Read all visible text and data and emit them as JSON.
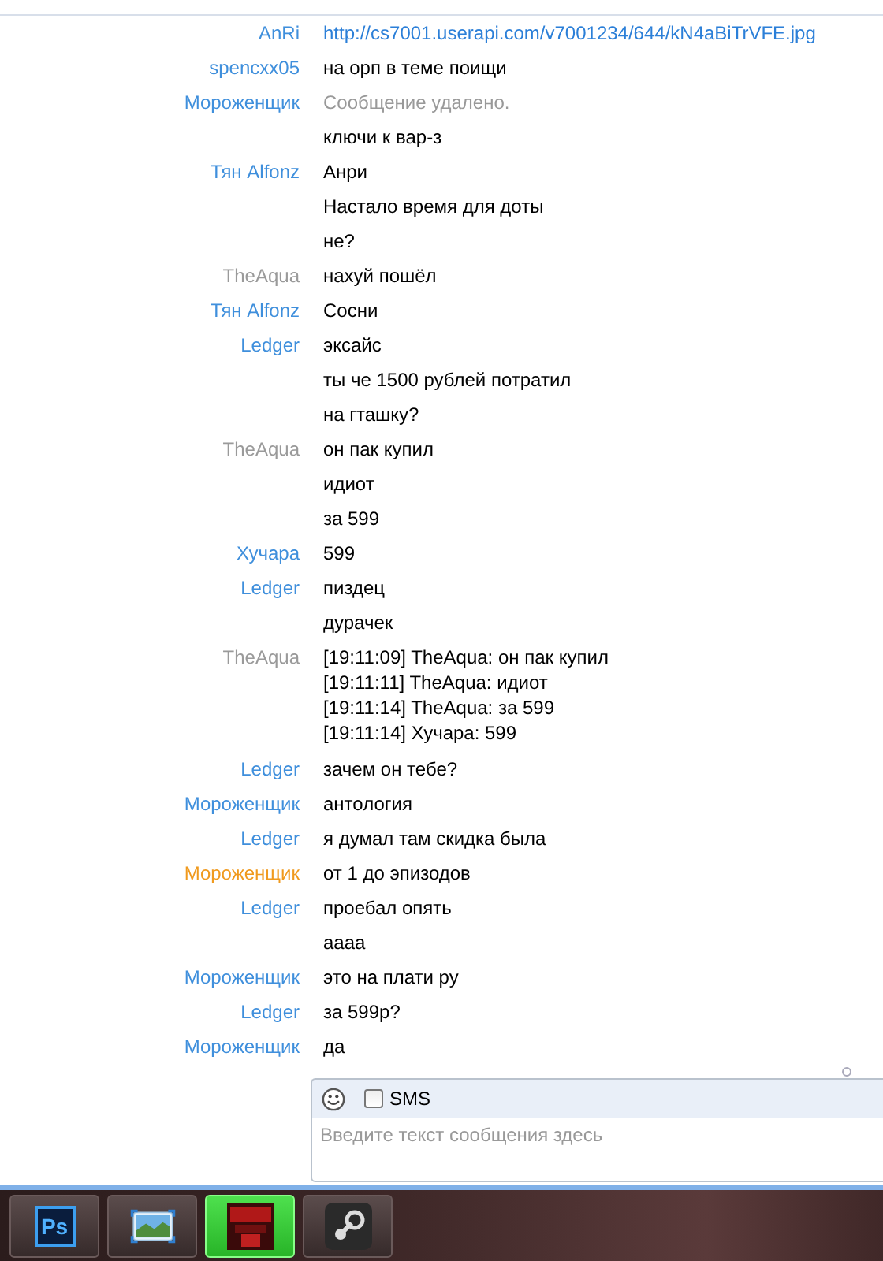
{
  "messages": [
    {
      "author": "AnRi",
      "color": "#3f8fdc",
      "kind": "link",
      "text": "http://cs7001.userapi.com/v7001234/644/kN4aBiTrVFE.jpg"
    },
    {
      "author": "spencxx05",
      "color": "#3f8fdc",
      "kind": "text",
      "text": "на орп в теме поищи"
    },
    {
      "author": "Мороженщик",
      "color": "#3f8fdc",
      "kind": "deleted",
      "text": "Сообщение удалено."
    },
    {
      "kind": "text",
      "text": "ключи к вар-з"
    },
    {
      "author": "Тян Alfonz",
      "color": "#3f8fdc",
      "kind": "text",
      "text": "Анри"
    },
    {
      "kind": "text",
      "text": "Настало время для доты"
    },
    {
      "kind": "text",
      "text": "не?"
    },
    {
      "author": "TheAqua",
      "color": "#9a9a9a",
      "kind": "text",
      "text": "нахуй пошёл"
    },
    {
      "author": "Тян Alfonz",
      "color": "#3f8fdc",
      "kind": "text",
      "text": "Сосни"
    },
    {
      "author": "Ledger",
      "color": "#3f8fdc",
      "kind": "text",
      "text": "эксайс"
    },
    {
      "kind": "text",
      "text": "ты че 1500 рублей потратил"
    },
    {
      "kind": "text",
      "text": "на гташку?"
    },
    {
      "author": "TheAqua",
      "color": "#9a9a9a",
      "kind": "text",
      "text": "он пак купил"
    },
    {
      "kind": "text",
      "text": "идиот"
    },
    {
      "kind": "text",
      "text": "за 599"
    },
    {
      "author": "Хучара",
      "color": "#3f8fdc",
      "kind": "text",
      "text": "599"
    },
    {
      "author": "Ledger",
      "color": "#3f8fdc",
      "kind": "text",
      "text": "пиздец"
    },
    {
      "kind": "text",
      "text": "дурачек"
    },
    {
      "author": "TheAqua",
      "color": "#9a9a9a",
      "kind": "log",
      "lines": [
        "[19:11:09] TheAqua: он пак купил",
        "[19:11:11] TheAqua: идиот",
        "[19:11:14] TheAqua: за 599",
        "[19:11:14] Хучара: 599"
      ]
    },
    {
      "author": "Ledger",
      "color": "#3f8fdc",
      "kind": "text",
      "text": "зачем он тебе?"
    },
    {
      "author": "Мороженщик",
      "color": "#3f8fdc",
      "kind": "text",
      "text": "антология"
    },
    {
      "author": "Ledger",
      "color": "#3f8fdc",
      "kind": "text",
      "text": "я думал там скидка была"
    },
    {
      "author": "Мороженщик",
      "color": "#f09a1e",
      "kind": "text",
      "text": "от 1 до эпизодов"
    },
    {
      "author": "Ledger",
      "color": "#3f8fdc",
      "kind": "text",
      "text": "проебал опять"
    },
    {
      "kind": "text",
      "text": "аааа"
    },
    {
      "author": "Мороженщик",
      "color": "#3f8fdc",
      "kind": "text",
      "text": "это на плати ру"
    },
    {
      "author": "Ledger",
      "color": "#3f8fdc",
      "kind": "text",
      "text": "за 599р?"
    },
    {
      "author": "Мороженщик",
      "color": "#3f8fdc",
      "kind": "text",
      "text": "да"
    }
  ],
  "composer": {
    "sms": {
      "label": "SMS",
      "checked": false
    },
    "placeholder": "Введите текст сообщения здесь"
  },
  "taskbar": {
    "items": [
      {
        "kind": "editor",
        "label": "Ps",
        "selected": false
      },
      {
        "kind": "photos",
        "selected": false
      },
      {
        "kind": "game",
        "selected": true
      },
      {
        "kind": "launcher",
        "selected": false
      }
    ]
  }
}
